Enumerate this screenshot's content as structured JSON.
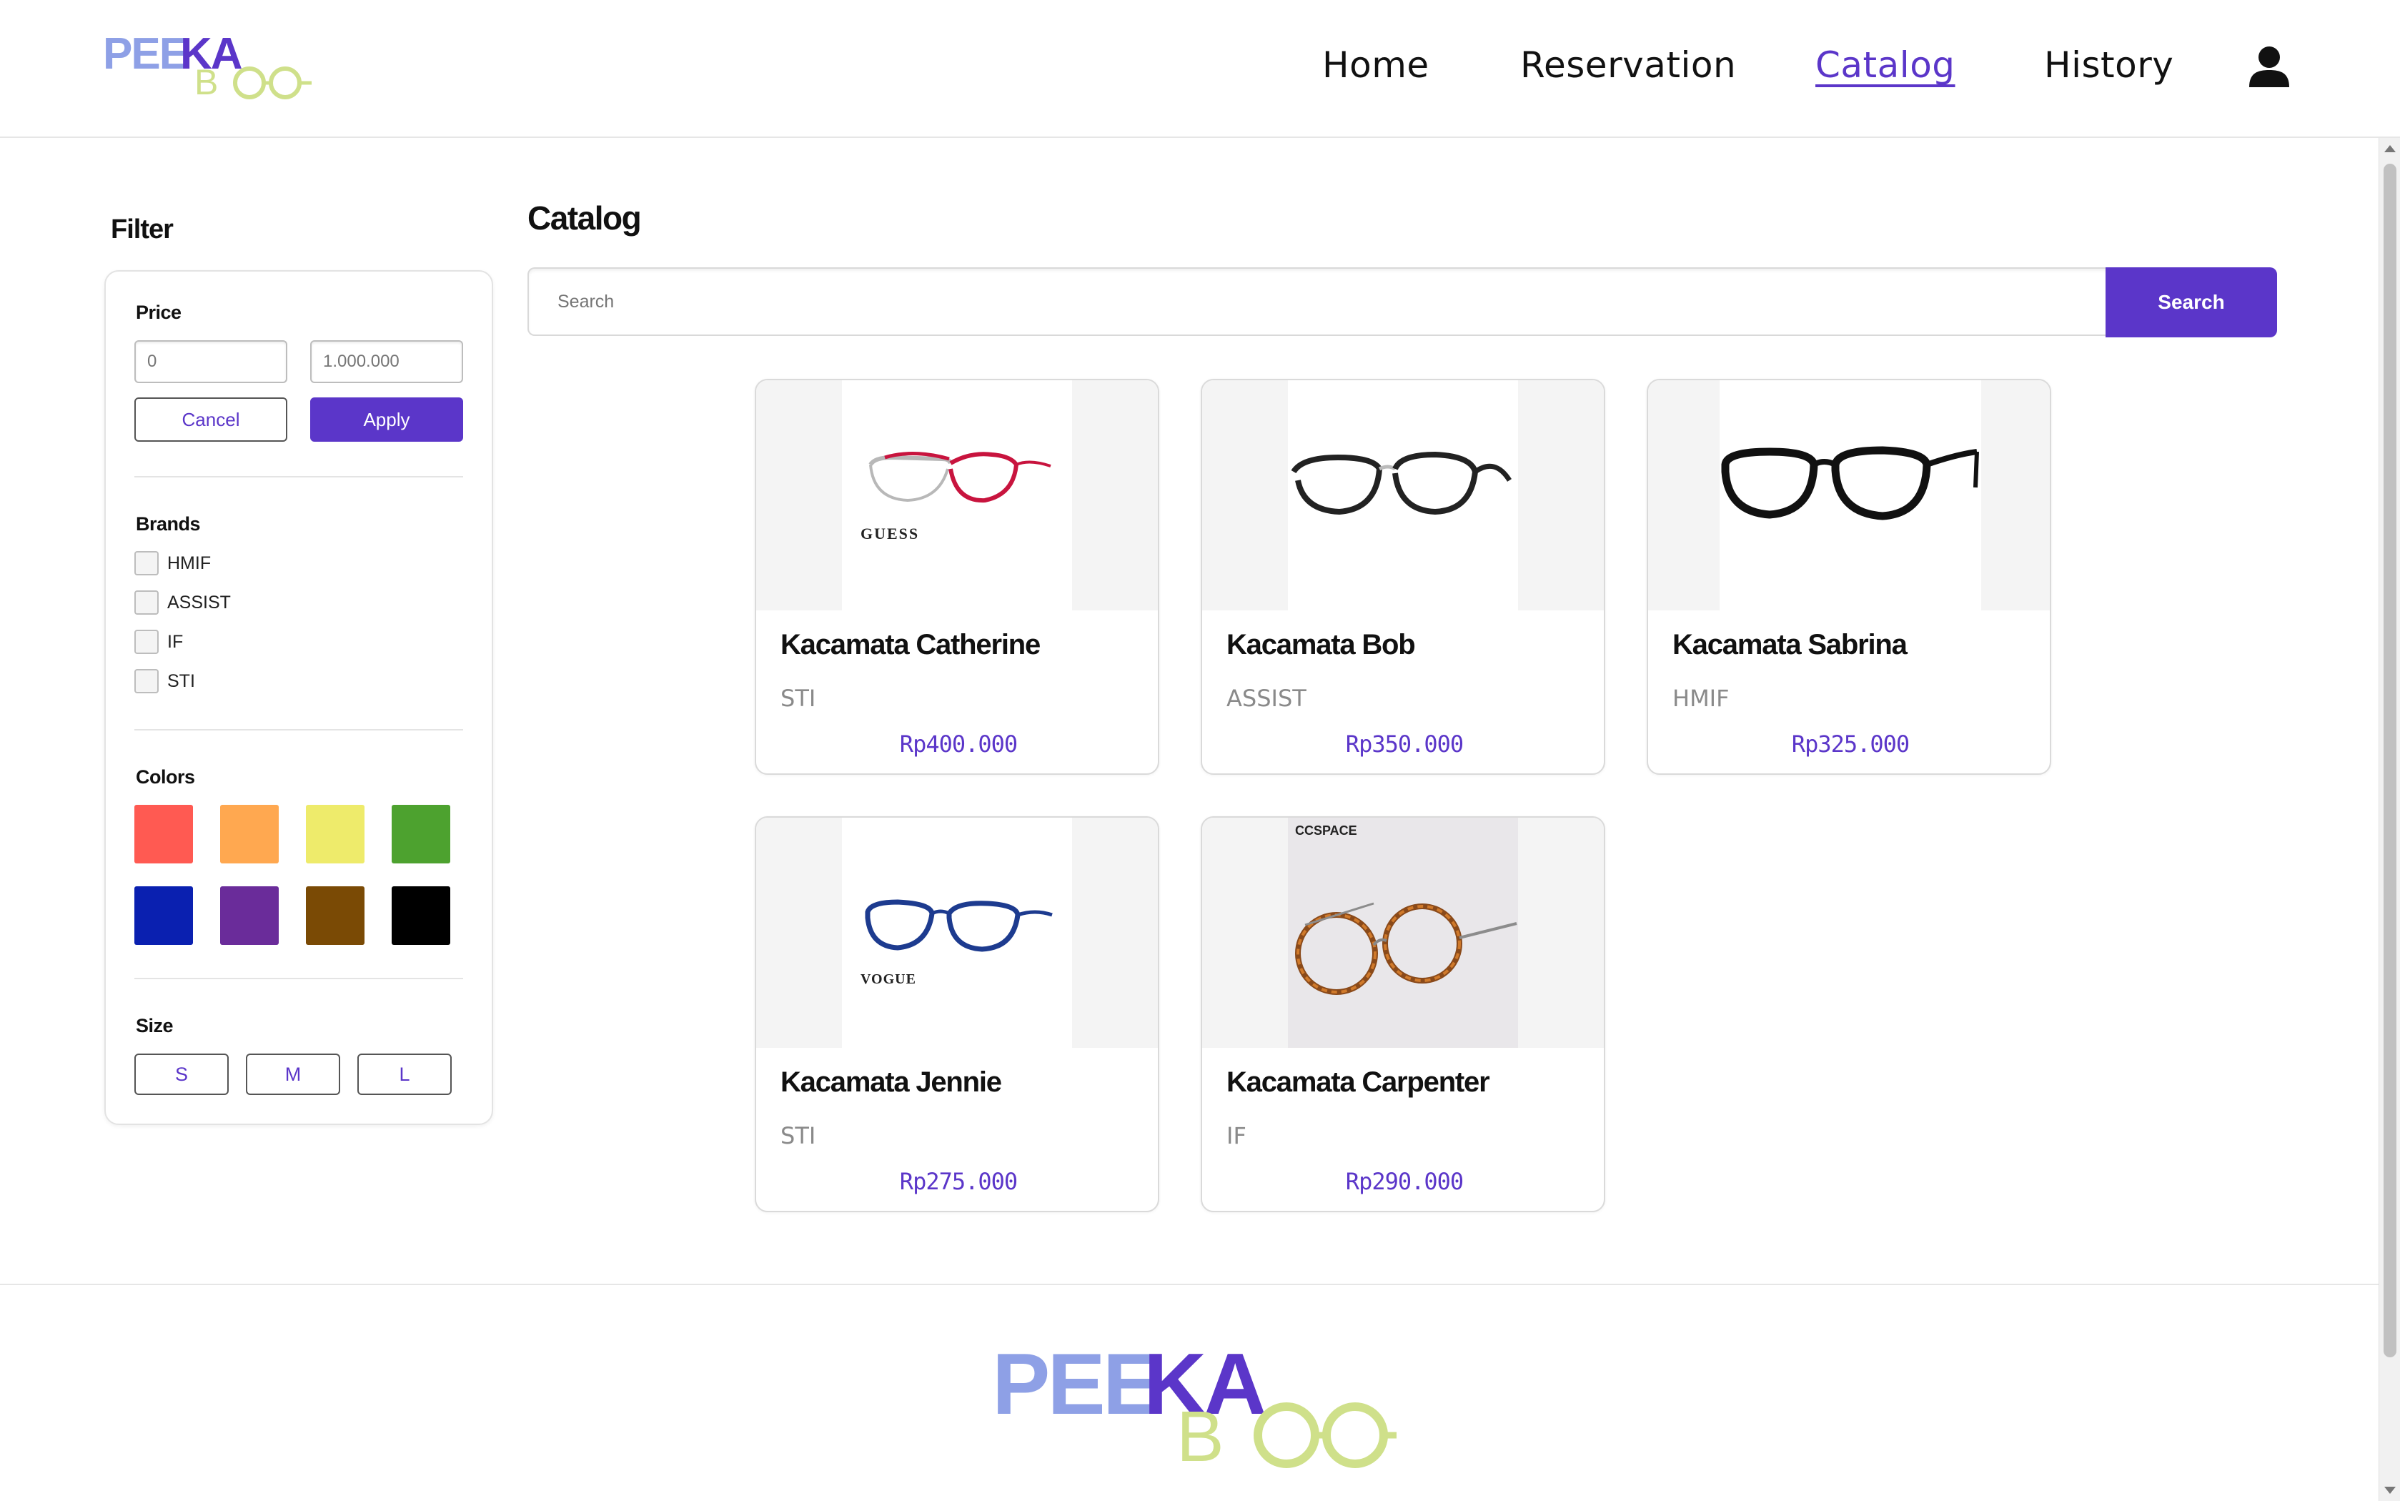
{
  "brand": {
    "logo_text_top": "PEEKA",
    "logo_text_bottom": "BOO",
    "colors": {
      "accent": "#5b36c9",
      "logo_blue": "#8ea0e6",
      "logo_purple": "#5b36c9",
      "logo_green": "#cfe08a"
    }
  },
  "nav": {
    "items": [
      {
        "label": "Home",
        "active": false
      },
      {
        "label": "Reservation",
        "active": false
      },
      {
        "label": "Catalog",
        "active": true
      },
      {
        "label": "History",
        "active": false
      }
    ],
    "user_icon": "user-icon"
  },
  "filter": {
    "title": "Filter",
    "price": {
      "label": "Price",
      "min_placeholder": "0",
      "max_placeholder": "1.000.000",
      "cancel_label": "Cancel",
      "apply_label": "Apply"
    },
    "brands": {
      "label": "Brands",
      "items": [
        "HMIF",
        "ASSIST",
        "IF",
        "STI"
      ]
    },
    "colors": {
      "label": "Colors",
      "swatches": [
        "#ff5a52",
        "#ffa850",
        "#eeeb6b",
        "#4da22f",
        "#0a20b0",
        "#6a2c9a",
        "#7a4a05",
        "#000000"
      ]
    },
    "size": {
      "label": "Size",
      "options": [
        "S",
        "M",
        "L"
      ]
    }
  },
  "catalog": {
    "title": "Catalog",
    "search_placeholder": "Search",
    "search_button": "Search",
    "products": [
      {
        "name": "Kacamata Catherine",
        "brand": "STI",
        "price": "Rp400.000",
        "image_label": "GUESS"
      },
      {
        "name": "Kacamata Bob",
        "brand": "ASSIST",
        "price": "Rp350.000",
        "image_label": ""
      },
      {
        "name": "Kacamata Sabrina",
        "brand": "HMIF",
        "price": "Rp325.000",
        "image_label": ""
      },
      {
        "name": "Kacamata Jennie",
        "brand": "STI",
        "price": "Rp275.000",
        "image_label": "VOGUE"
      },
      {
        "name": "Kacamata Carpenter",
        "brand": "IF",
        "price": "Rp290.000",
        "image_label": "CCSPACE"
      }
    ]
  }
}
